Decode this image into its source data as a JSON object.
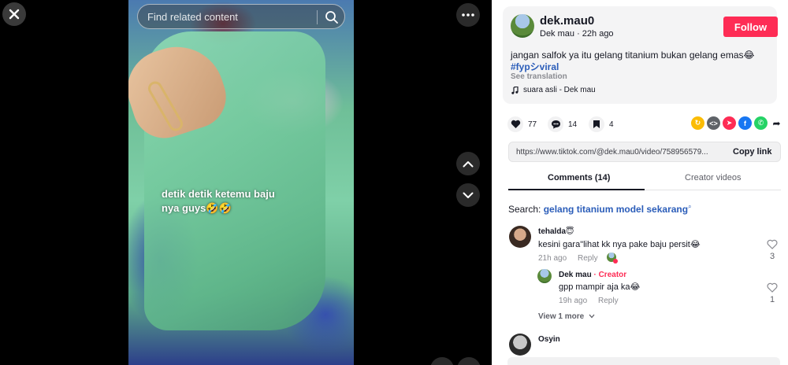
{
  "video": {
    "search_placeholder": "Find related content",
    "overlay_text": "detik detik ketemu baju nya guys🤣🤣"
  },
  "post": {
    "author_name": "dek.mau0",
    "author_meta": "Dek mau · 22h ago",
    "follow_label": "Follow",
    "caption": "jangan salfok ya itu gelang titanium bukan gelang emas😂",
    "hashtags": "#fypシviral",
    "see_translation": "See translation",
    "music": "suara asli - Dek mau"
  },
  "actions": {
    "likes": "77",
    "comments": "14",
    "saves": "4"
  },
  "share_icon_colors": [
    "#fbbc05",
    "#5f6368",
    "#fe2c55",
    "#1877f2",
    "#25d366"
  ],
  "link": {
    "url": "https://www.tiktok.com/@dek.mau0/video/758956579...",
    "copy_label": "Copy link"
  },
  "tabs": {
    "comments": "Comments (14)",
    "creator_videos": "Creator videos"
  },
  "search_suggest": {
    "prefix": "Search:",
    "query": "gelang titanium model sekarang"
  },
  "comments": [
    {
      "name": "tehalda😇",
      "text": "kesini gara\"lihat kk nya pake baju persit😂",
      "time": "21h ago",
      "reply": "Reply",
      "likes": "3"
    },
    {
      "name": "Dek mau",
      "creator": "· Creator",
      "text": "gpp mampir aja ka😂",
      "time": "19h ago",
      "reply": "Reply",
      "likes": "1"
    },
    {
      "name": "Osyin"
    }
  ],
  "view_more": "View 1 more"
}
